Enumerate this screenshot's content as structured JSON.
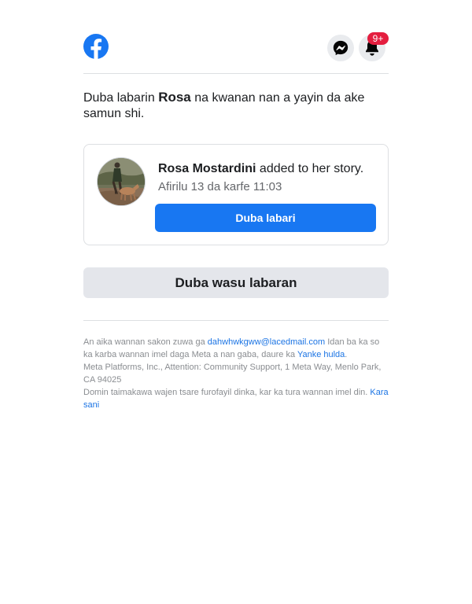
{
  "header": {
    "logo_icon": "facebook-logo",
    "messenger_icon": "messenger-icon",
    "notifications_icon": "bell-icon",
    "notification_badge": "9+"
  },
  "intro": {
    "prefix": "Duba labarin",
    "name": "Rosa",
    "suffix": "na kwanan nan a yayin da ake samun shi."
  },
  "story_card": {
    "author": "Rosa Mostardini",
    "action": "added to her story.",
    "timestamp": "Afirilu 13 da karfe 11:03",
    "view_button": "Duba labari"
  },
  "more_button": "Duba wasu labaran",
  "footer": {
    "line1_prefix": "An aika wannan sakon zuwa ga",
    "email": "dahwhwkgww@lacedmail.com",
    "line1_suffix": "Idan ba ka so ka karba wannan imel daga Meta a nan gaba, daure ka",
    "unsubscribe_link": "Yanke hulda",
    "line1_end": ".",
    "address": "Meta Platforms, Inc., Attention: Community Support, 1 Meta Way, Menlo Park, CA 94025",
    "security_text": "Domin taimakawa wajen tsare furofayil dinka, kar ka tura wannan imel din.",
    "learn_more_link": "Kara sani"
  },
  "colors": {
    "brand_blue": "#1877f2",
    "badge_red": "#e41e3f",
    "link_blue": "#1b74e4"
  }
}
